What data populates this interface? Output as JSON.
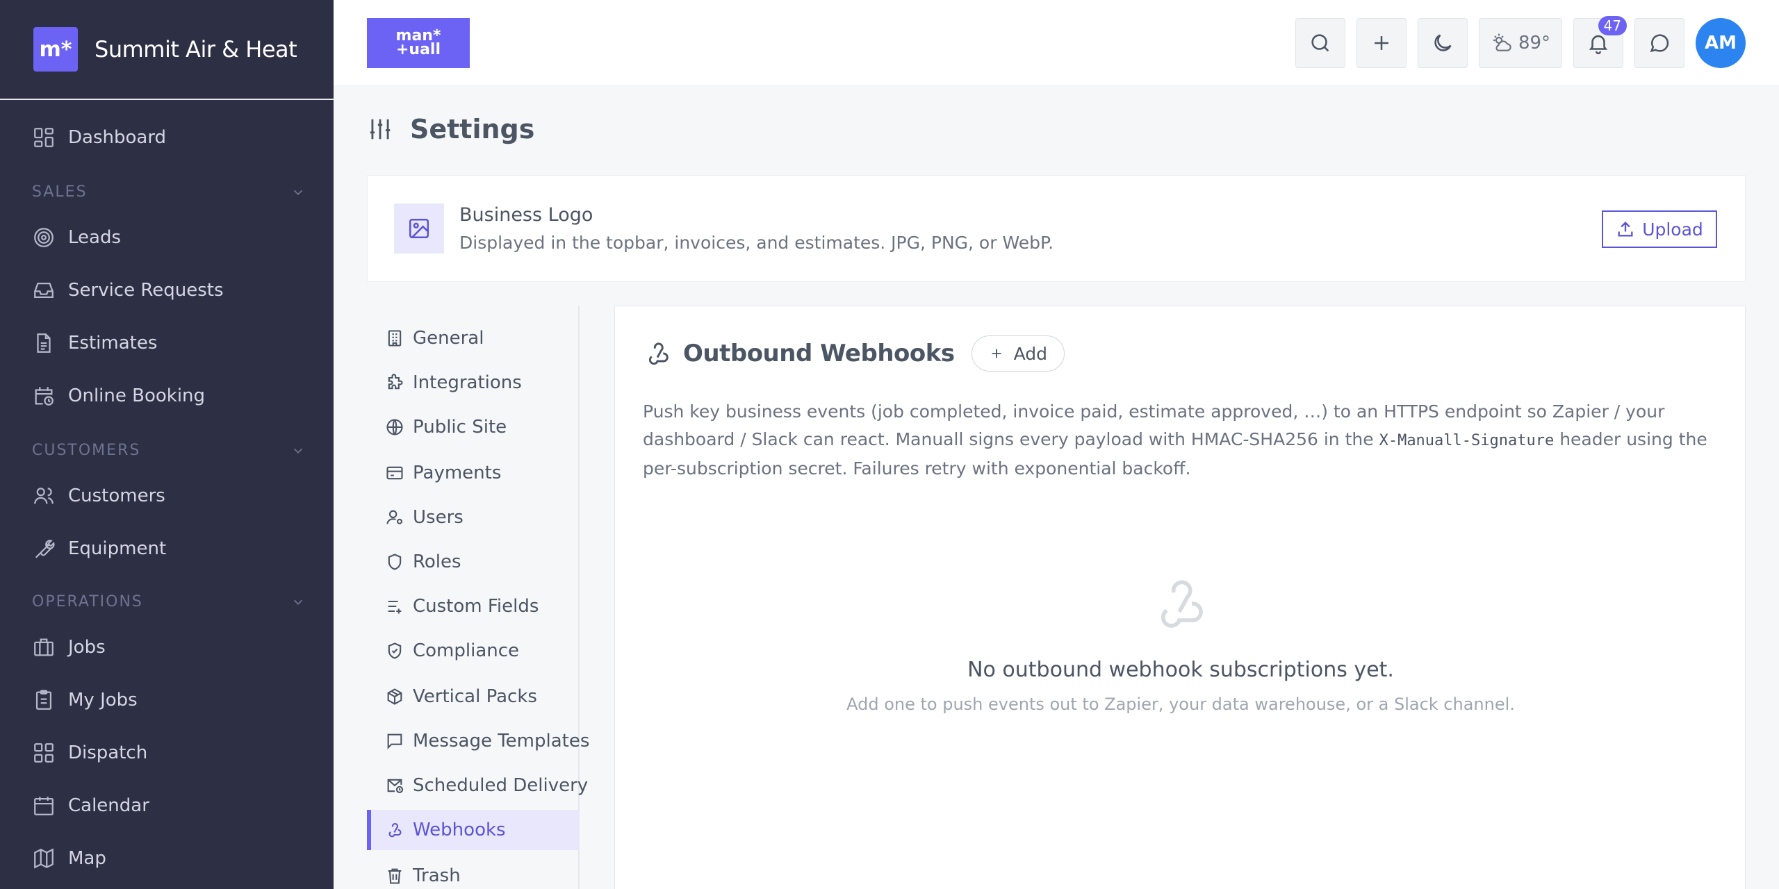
{
  "brand": {
    "logo_text": "m*",
    "name": "Summit Air & Heat"
  },
  "sidebar": {
    "dashboard": "Dashboard",
    "sections": {
      "sales": "SALES",
      "customers": "CUSTOMERS",
      "operations": "OPERATIONS"
    },
    "items": {
      "leads": "Leads",
      "service_requests": "Service Requests",
      "estimates": "Estimates",
      "online_booking": "Online Booking",
      "customers": "Customers",
      "equipment": "Equipment",
      "jobs": "Jobs",
      "my_jobs": "My Jobs",
      "dispatch": "Dispatch",
      "calendar": "Calendar",
      "map": "Map"
    }
  },
  "topbar": {
    "app_logo_line1": "man*",
    "app_logo_line2": "+uall",
    "weather": "89°",
    "notifications_count": "47",
    "avatar_initials": "AM"
  },
  "page": {
    "title": "Settings"
  },
  "logo_card": {
    "title": "Business Logo",
    "description": "Displayed in the topbar, invoices, and estimates. JPG, PNG, or WebP.",
    "upload_label": "Upload"
  },
  "subnav": {
    "general": "General",
    "integrations": "Integrations",
    "public_site": "Public Site",
    "payments": "Payments",
    "users": "Users",
    "roles": "Roles",
    "custom_fields": "Custom Fields",
    "compliance": "Compliance",
    "vertical_packs": "Vertical Packs",
    "message_templates": "Message Templates",
    "scheduled_delivery": "Scheduled Delivery",
    "webhooks": "Webhooks",
    "trash": "Trash"
  },
  "webhooks": {
    "title": "Outbound Webhooks",
    "add_label": "Add",
    "desc_part1": "Push key business events (job completed, invoice paid, estimate approved, …) to an HTTPS endpoint so Zapier / your dashboard / Slack can react. Manuall signs every payload with HMAC-SHA256 in the ",
    "desc_code": "X-Manuall-Signature",
    "desc_part2": " header using the per-subscription secret. Failures retry with exponential backoff.",
    "empty_title": "No outbound webhook subscriptions yet.",
    "empty_subtitle": "Add one to push events out to Zapier, your data warehouse, or a Slack channel."
  }
}
